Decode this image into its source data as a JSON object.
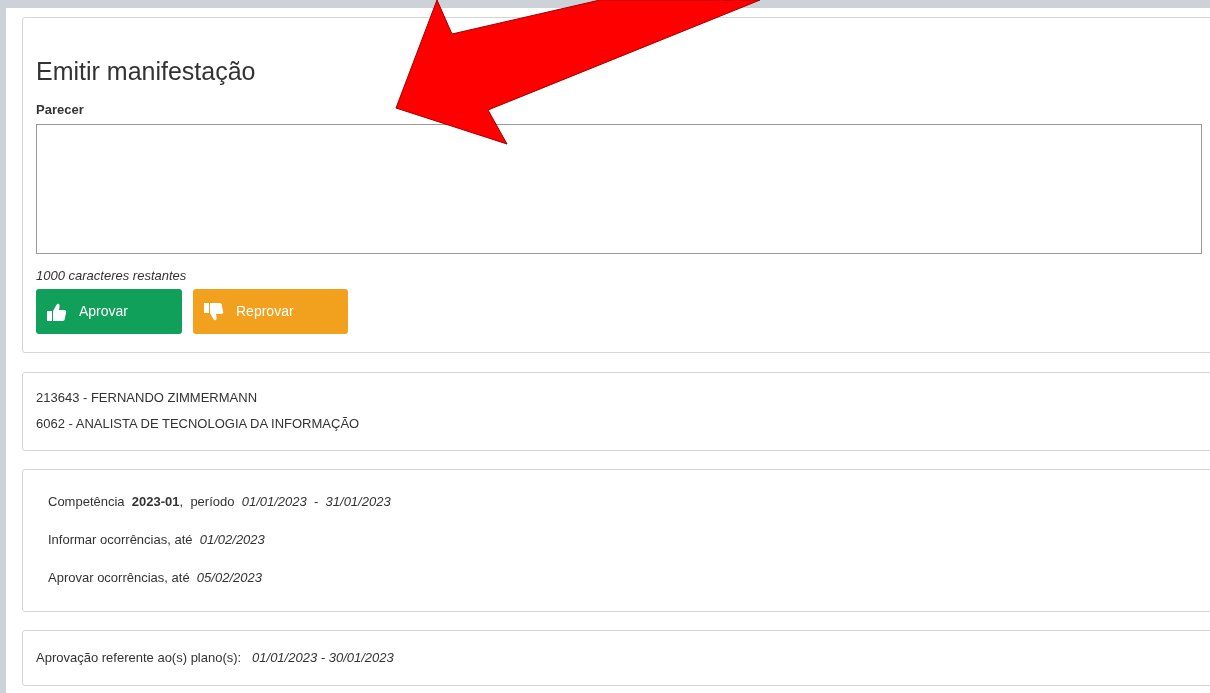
{
  "manifestation": {
    "title": "Emitir manifestação",
    "field_label": "Parecer",
    "char_counter": "1000 caracteres restantes",
    "buttons": [
      {
        "label": "Aprovar",
        "kind": "approve"
      },
      {
        "label": "Reprovar",
        "kind": "reject"
      }
    ]
  },
  "employee": {
    "lines": [
      "213643 - FERNANDO ZIMMERMANN",
      "6062 - ANALISTA DE TECNOLOGIA DA INFORMAÇÃO"
    ]
  },
  "period": {
    "lines": [
      "Competência  **2023-01**,  período  *01/01/2023*  -  *31/01/2023*",
      "Informar ocorrências, até  *01/02/2023*",
      "Aprovar ocorrências, até  *05/02/2023*"
    ]
  },
  "plans": {
    "text": "Aprovação referente ao(s) plano(s):   *01/01/2023 - 30/01/2023*"
  }
}
